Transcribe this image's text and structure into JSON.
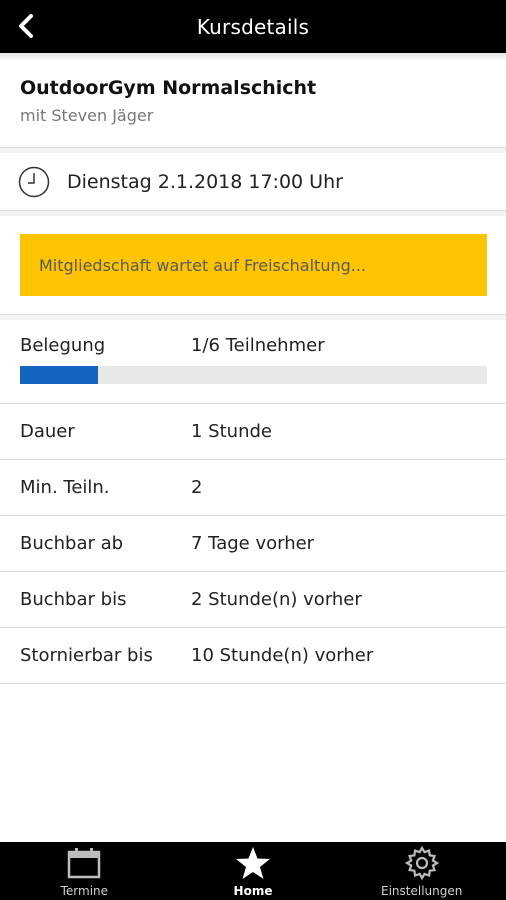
{
  "header": {
    "title": "Kursdetails",
    "back_icon": "chevron-left-icon"
  },
  "course": {
    "title": "OutdoorGym Normalschicht",
    "trainer": "mit Steven Jäger"
  },
  "schedule": {
    "icon": "clock-icon",
    "datetime": "Dienstag 2.1.2018 17:00 Uhr"
  },
  "notice": {
    "text": "Mitgliedschaft wartet auf Freischaltung...",
    "color": "#ffc400"
  },
  "occupancy": {
    "label": "Belegung",
    "value": "1/6 Teilnehmer",
    "booked": 1,
    "capacity": 6,
    "bar_color": "#1565c0"
  },
  "details": [
    {
      "label": "Dauer",
      "value": "1 Stunde"
    },
    {
      "label": "Min. Teiln.",
      "value": "2"
    },
    {
      "label": "Buchbar ab",
      "value": "7 Tage vorher"
    },
    {
      "label": "Buchbar bis",
      "value": "2 Stunde(n) vorher"
    },
    {
      "label": "Stornierbar bis",
      "value": "10 Stunde(n) vorher"
    }
  ],
  "bottom_nav": {
    "items": [
      {
        "label": "Termine",
        "icon": "calendar-icon",
        "active": false
      },
      {
        "label": "Home",
        "icon": "star-icon",
        "active": true
      },
      {
        "label": "Einstellungen",
        "icon": "gear-icon",
        "active": false
      }
    ]
  }
}
